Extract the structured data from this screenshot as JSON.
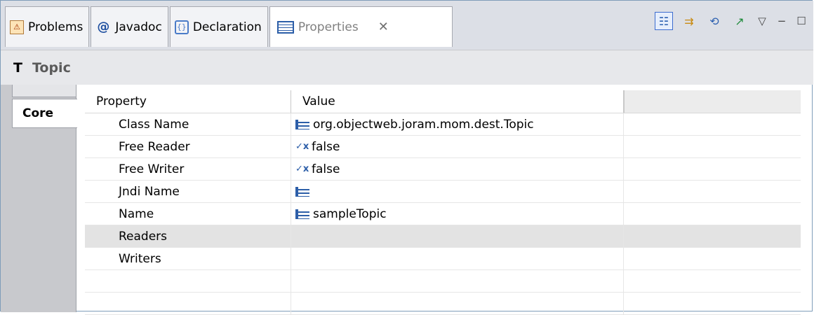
{
  "tabs": [
    {
      "label": "Problems",
      "icon": "problems-icon"
    },
    {
      "label": "Javadoc",
      "icon": "at-icon"
    },
    {
      "label": "Declaration",
      "icon": "declaration-icon"
    },
    {
      "label": "Properties",
      "icon": "properties-icon",
      "active": true,
      "close": "✕"
    }
  ],
  "toolbar": {
    "buttons": [
      "show-categories-icon",
      "show-advanced-icon",
      "restore-default-icon",
      "pin-icon"
    ],
    "menu": "▽",
    "minimize": "−",
    "maximize": "☐"
  },
  "title": {
    "type_glyph": "T",
    "text": "Topic"
  },
  "side_tabs": {
    "core": "Core"
  },
  "table": {
    "headers": {
      "property": "Property",
      "value": "Value"
    },
    "rows": [
      {
        "property": "Class Name",
        "value": "org.objectweb.joram.mom.dest.Topic",
        "icon": "text-value-icon"
      },
      {
        "property": "Free Reader",
        "value": "false",
        "icon": "boolean-value-icon"
      },
      {
        "property": "Free Writer",
        "value": "false",
        "icon": "boolean-value-icon"
      },
      {
        "property": "Jndi Name",
        "value": "",
        "icon": "text-value-icon"
      },
      {
        "property": "Name",
        "value": "sampleTopic",
        "icon": "text-value-icon"
      },
      {
        "property": "Readers",
        "value": "",
        "icon": "",
        "selected": true
      },
      {
        "property": "Writers",
        "value": "",
        "icon": ""
      },
      {
        "property": "",
        "value": "",
        "icon": ""
      },
      {
        "property": "",
        "value": "",
        "icon": ""
      }
    ]
  },
  "colors": {
    "accent": "#2c5ea8",
    "selected_row": "#e3e3e3",
    "tabbar": "#dcdfe6"
  }
}
